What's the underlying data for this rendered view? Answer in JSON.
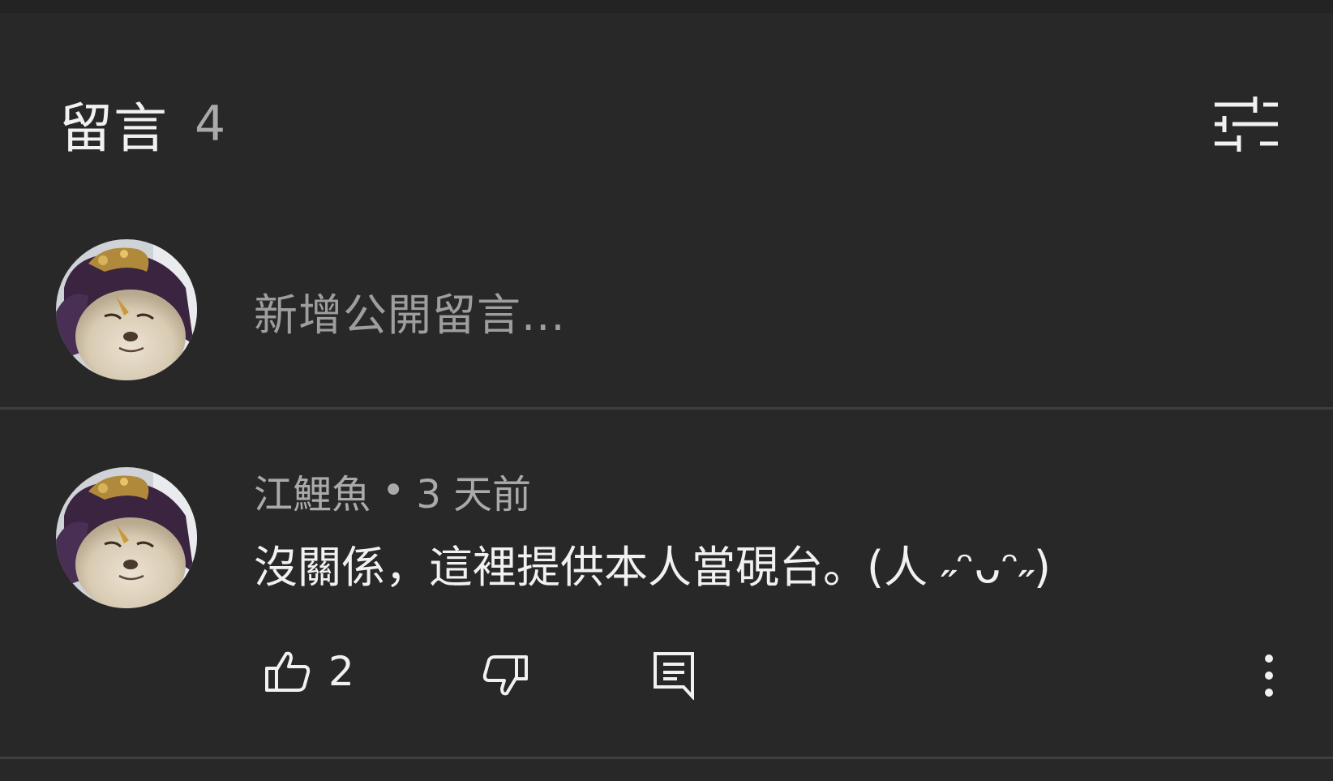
{
  "header": {
    "title": "留言",
    "count": "4",
    "filter_icon": "sliders-icon"
  },
  "composer": {
    "placeholder": "新增公開留言...",
    "avatar_icon": "user-avatar"
  },
  "comments": [
    {
      "author": "江鯉魚",
      "separator": "•",
      "time": "3 天前",
      "text": "沒關係，這裡提供本人當硯台。(人 ˶ᵔᴗᵔ˶)",
      "likes": "2",
      "icons": {
        "like": "thumbs-up-icon",
        "dislike": "thumbs-down-icon",
        "reply": "reply-icon",
        "more": "more-vertical-icon"
      }
    }
  ],
  "colors": {
    "background": "#282828",
    "text_primary": "#f1f1f1",
    "text_secondary": "#aaaaaa",
    "divider": "#3f3f3f"
  }
}
